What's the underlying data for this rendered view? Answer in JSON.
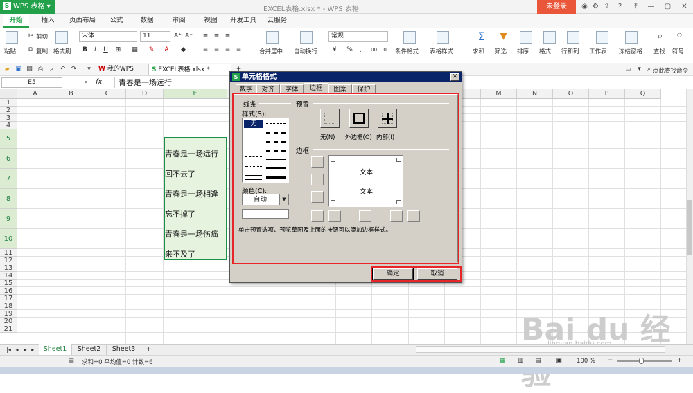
{
  "app": {
    "name": "WPS 表格",
    "doc_title": "EXCEL表格.xlsx * - WPS 表格",
    "login": "未登录"
  },
  "menu": [
    "开始",
    "插入",
    "页面布局",
    "公式",
    "数据",
    "审阅",
    "视图",
    "开发工具",
    "云服务"
  ],
  "ribbon": {
    "paste": "粘贴",
    "cut": "剪切",
    "copy": "复制",
    "format_painter": "格式刷",
    "font_name": "宋体",
    "font_size": "11",
    "merge": "合并居中",
    "wrap": "自动换行",
    "number_format": "常规",
    "cond_format": "条件格式",
    "table_style": "表格样式",
    "sum": "求和",
    "filter": "筛选",
    "sort": "排序",
    "format": "格式",
    "rows_cols": "行和列",
    "worksheet": "工作表",
    "freeze": "冻结窗格",
    "find": "查找",
    "symbol": "符号"
  },
  "quickbar": {
    "tab1": "我的WPS",
    "tab2": "EXCEL表格.xlsx *",
    "find_cmd": "点此查找命令"
  },
  "formula": {
    "namebox": "E5",
    "fx": "fx",
    "content": "青春是一场远行"
  },
  "columns": [
    "A",
    "B",
    "C",
    "D",
    "E",
    "F",
    "G",
    "H",
    "I",
    "J",
    "K",
    "L",
    "M",
    "N",
    "O",
    "P",
    "Q"
  ],
  "rows": [
    "1",
    "2",
    "3",
    "4",
    "5",
    "6",
    "7",
    "8",
    "9",
    "10",
    "11",
    "12",
    "13",
    "14",
    "15",
    "16",
    "17",
    "18",
    "19",
    "20",
    "21"
  ],
  "cells": {
    "E5": "青春是一场远行",
    "E6": "回不去了",
    "E7": "青春是一场相逢",
    "E8": "忘不掉了",
    "E9": "青春是一场伤痛",
    "E10": "来不及了"
  },
  "sheets": [
    "Sheet1",
    "Sheet2",
    "Sheet3"
  ],
  "status": {
    "summary": "求和=0  平均值=0  计数=6",
    "zoom": "100 %"
  },
  "dialog": {
    "title": "单元格格式",
    "tabs": [
      "数字",
      "对齐",
      "字体",
      "边框",
      "图案",
      "保护"
    ],
    "active_tab": "边框",
    "line_group": "线条",
    "style_label": "样式(S):",
    "none_style": "无",
    "color_label": "颜色(C):",
    "color_value": "自动",
    "preset_group": "预置",
    "preset_none": "无(N)",
    "preset_outline": "外边框(O)",
    "preset_inside": "内部(I)",
    "border_group": "边框",
    "preview_text_top": "文本",
    "preview_text_bottom": "文本",
    "hint": "单击预置选项、预览草图及上面的按钮可以添加边框样式。",
    "ok": "确定",
    "cancel": "取消"
  },
  "watermark": {
    "brand": "Bai du 经验",
    "url": "jingyan.baidu.com"
  },
  "colors": {
    "accent": "#23a14a",
    "dialog_bg": "#d4d0c8",
    "highlight_red": "#e8262a",
    "dialog_title": "#0a246a"
  }
}
